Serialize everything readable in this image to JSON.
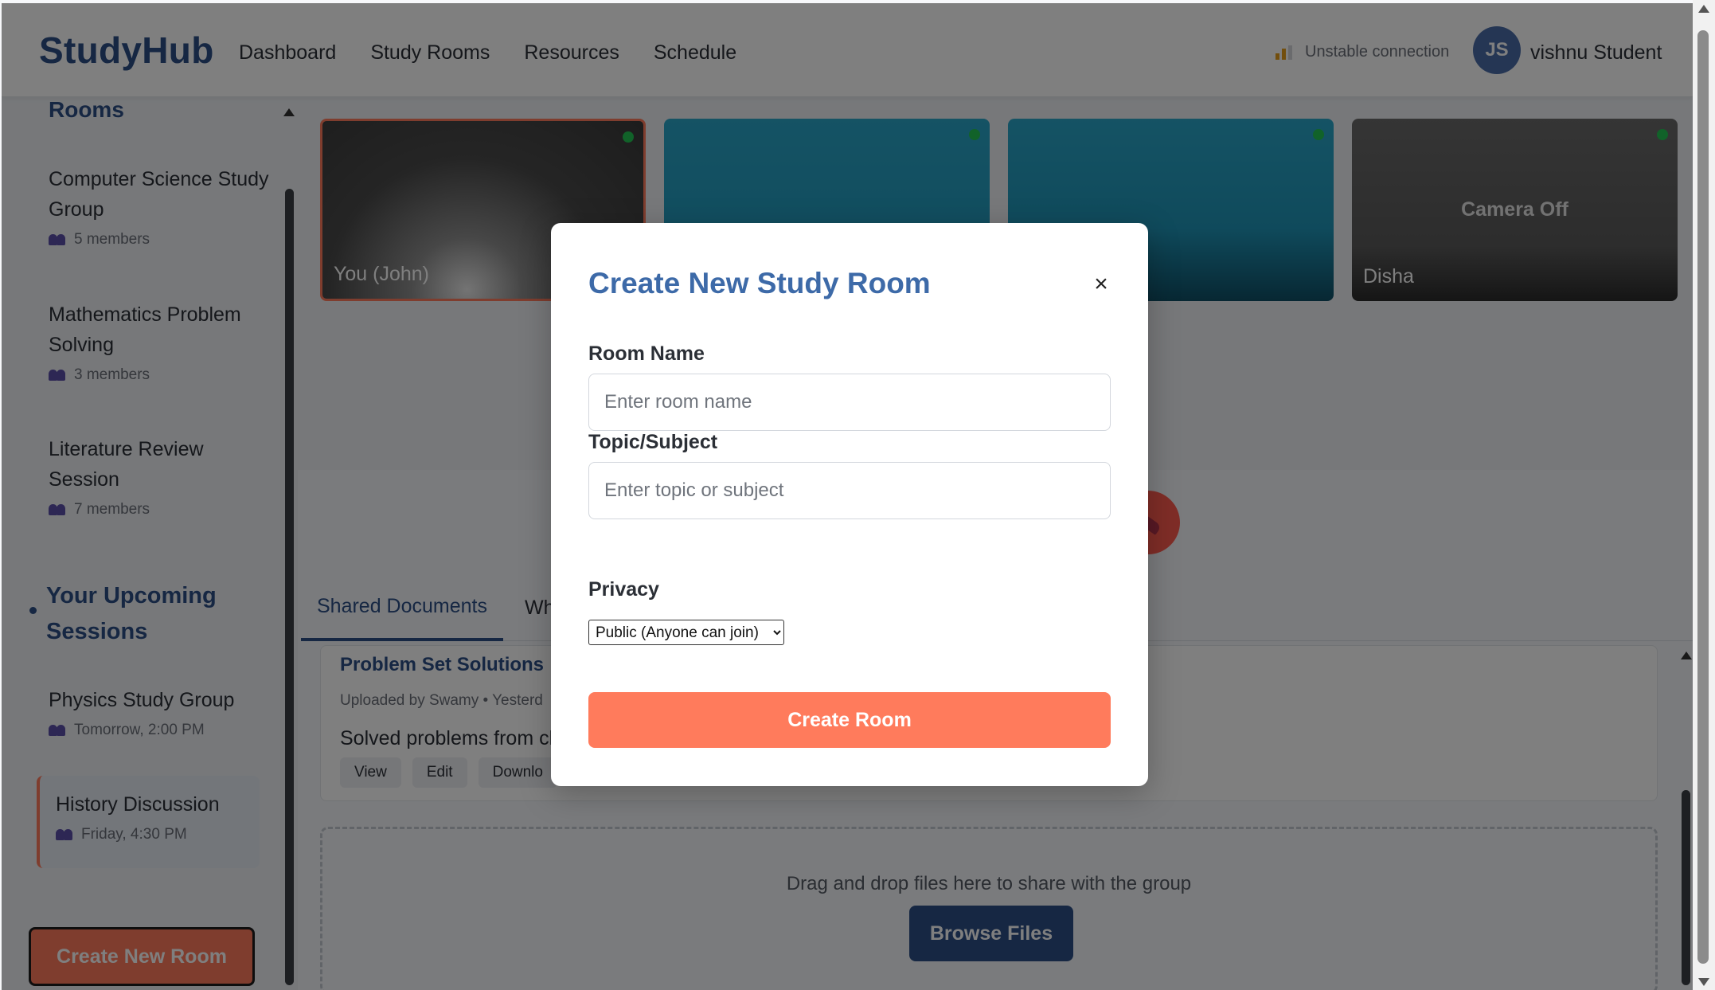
{
  "header": {
    "logo": "StudyHub",
    "nav": [
      "Dashboard",
      "Study Rooms",
      "Resources",
      "Schedule"
    ],
    "connection_status": "Unstable connection",
    "user_initials": "JS",
    "user_name": "vishnu Student"
  },
  "sidebar": {
    "rooms_title": "Rooms",
    "rooms": [
      {
        "name": "Computer Science Study Group",
        "members": "5 members"
      },
      {
        "name": "Mathematics Problem Solving",
        "members": "3 members"
      },
      {
        "name": "Literature Review Session",
        "members": "7 members"
      }
    ],
    "sessions_title": "Your Upcoming Sessions",
    "sessions": [
      {
        "name": "Physics Study Group",
        "time": "Tomorrow, 2:00 PM"
      },
      {
        "name": "History Discussion",
        "time": "Friday, 4:30 PM"
      }
    ],
    "create_button": "Create New Room"
  },
  "video": {
    "tiles": [
      {
        "label": "You (John)"
      },
      {
        "label": ""
      },
      {
        "label": ""
      },
      {
        "label": "Disha",
        "status": "Camera Off"
      }
    ]
  },
  "tabs": {
    "active": "Shared Documents",
    "second": "Wh"
  },
  "document": {
    "title": "Problem Set Solutions",
    "meta": "Uploaded by Swamy  •  Yesterd",
    "description": "Solved problems from ch",
    "actions": [
      "View",
      "Edit",
      "Downlo"
    ]
  },
  "dropzone": {
    "text": "Drag and drop files here to share with the group",
    "button": "Browse Files"
  },
  "modal": {
    "title": "Create New Study Room",
    "close": "×",
    "room_name_label": "Room Name",
    "room_name_placeholder": "Enter room name",
    "topic_label": "Topic/Subject",
    "topic_placeholder": "Enter topic or subject",
    "privacy_label": "Privacy",
    "privacy_value": "Public (Anyone can join)",
    "submit": "Create Room"
  },
  "colors": {
    "brand": "#2c4f86",
    "accent": "#ff7b5c",
    "live": "#23c552"
  }
}
